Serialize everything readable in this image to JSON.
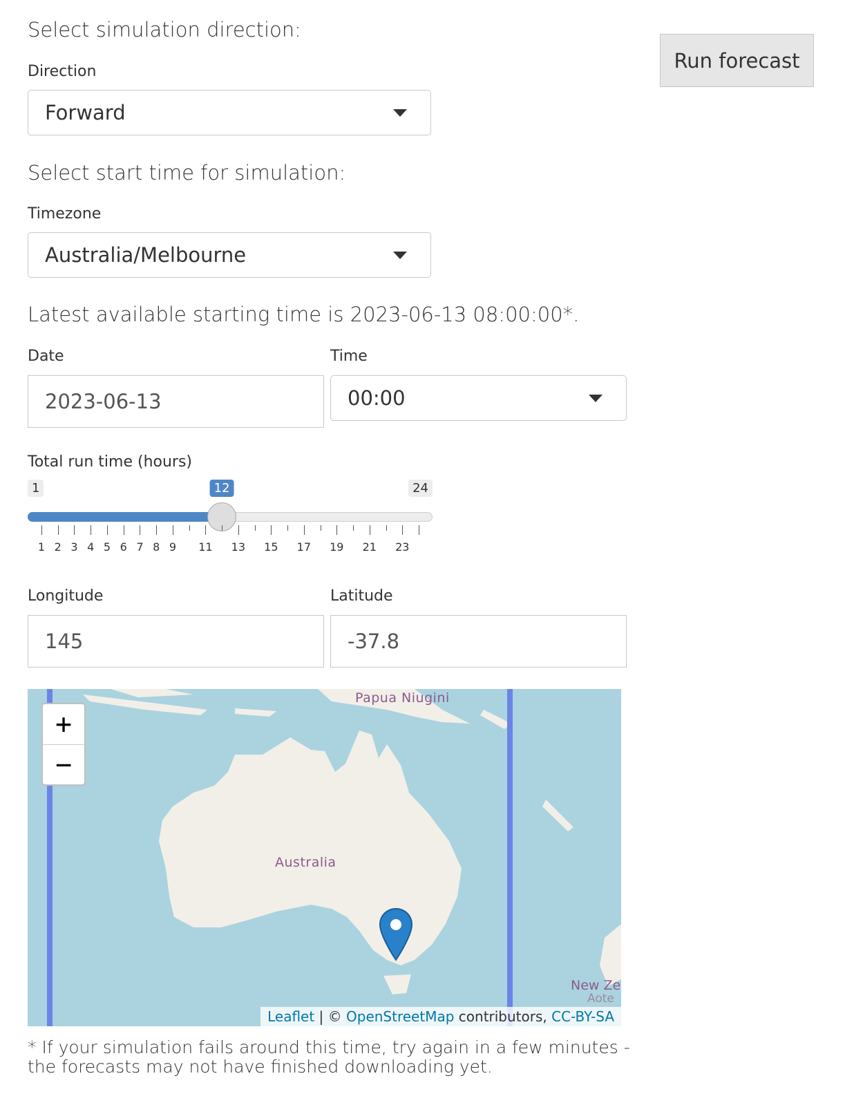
{
  "direction_section": {
    "heading": "Select simulation direction:",
    "label": "Direction",
    "value": "Forward"
  },
  "run_button": {
    "label": "Run forecast"
  },
  "start_section": {
    "heading": "Select start time for simulation:",
    "timezone_label": "Timezone",
    "timezone_value": "Australia/Melbourne",
    "latest_text": "Latest available starting time is 2023-06-13 08:00:00*."
  },
  "date_field": {
    "label": "Date",
    "value": "2023-06-13"
  },
  "time_field": {
    "label": "Time",
    "value": "00:00"
  },
  "run_time_slider": {
    "label": "Total run time (hours)",
    "min": 1,
    "max": 24,
    "value": 12,
    "min_label": "1",
    "max_label": "24",
    "value_label": "12",
    "tick_labels": [
      "1",
      "2",
      "3",
      "4",
      "5",
      "6",
      "7",
      "8",
      "9",
      "11",
      "13",
      "15",
      "17",
      "19",
      "21",
      "23"
    ],
    "accent": "#4e87c6"
  },
  "longitude_field": {
    "label": "Longitude",
    "value": "145"
  },
  "latitude_field": {
    "label": "Latitude",
    "value": "-37.8"
  },
  "map": {
    "zoom_in": "+",
    "zoom_out": "−",
    "place_labels": {
      "papua": "Papua Niugini",
      "australia": "Australia",
      "nz": "New Ze",
      "nz2": "Aote"
    },
    "attribution": {
      "leaflet": "Leaflet",
      "sep": " | © ",
      "osm": "OpenStreetMap",
      "contrib": " contributors, ",
      "license": "CC-BY-SA"
    },
    "water_color": "#aad3df",
    "land_color": "#f2efe9",
    "boundary_color": "#6b84e8",
    "marker_color": "#2a81cb"
  },
  "footnote": "* If your simulation fails around this time, try again in a few minutes - the forecasts may not have finished downloading yet."
}
